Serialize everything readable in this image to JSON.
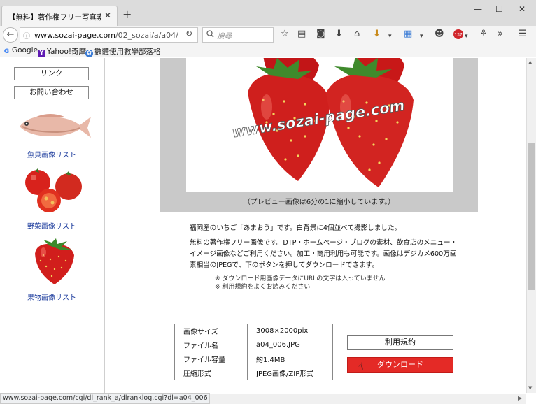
{
  "browser": {
    "tab_title": "【無料】著作権フリー写真素...",
    "new_tab": "+",
    "window_controls": [
      "—",
      "☐",
      "✕"
    ],
    "url_prefix": "www.sozai-page.com",
    "url_path": "/02_sozai/a/a04/",
    "search_placeholder": "搜尋",
    "toolbar_icons": [
      "star-icon",
      "reading-list-icon",
      "pocket-icon",
      "download-icon",
      "home-icon",
      "extension-download-icon",
      "extension-grid-icon",
      "chat-icon",
      "adblock-icon",
      "extension-icon",
      "overflow-icon",
      "menu-icon"
    ],
    "adblock_count": "137"
  },
  "bookmarks": [
    {
      "label": "Google",
      "icon": "google-icon"
    },
    {
      "label": "Yahoo!奇摩",
      "icon": "yahoo-icon"
    },
    {
      "label": "數體使用數學部落格",
      "icon": "blog-icon"
    }
  ],
  "sidebar": {
    "buttons": [
      "リンク",
      "お問い合わせ"
    ],
    "categories": [
      {
        "label": "魚貝画像リスト",
        "icon": "fish-thumbnail"
      },
      {
        "label": "野菜画像リスト",
        "icon": "tomato-thumbnail"
      },
      {
        "label": "果物画像リスト",
        "icon": "strawberry-thumbnail"
      }
    ]
  },
  "preview": {
    "watermark": "www.sozai-page.com",
    "note": "（プレビュー画像は6分の1に縮小しています。）"
  },
  "description": {
    "line1": "福岡産のいちご「あまおう」です。白背景に4個並べて撮影しました。",
    "line2": "無料の著作権フリー画像です。DTP・ホームページ・ブログの素材、飲食店のメニュー・",
    "line3": "イメージ画像などご利用ください。加工・商用利用も可能です。画像はデジカメ600万画",
    "line4": "素相当のJPEGで、下のボタンを押してダウンロードできます。",
    "note1": "※ ダウンロード用画像データにURLの文字は入っていません",
    "note2": "※ 利用規約をよくお読みください"
  },
  "info_table": [
    {
      "key": "画像サイズ",
      "value": "3008×2000pix"
    },
    {
      "key": "ファイル名",
      "value": "a04_006.JPG"
    },
    {
      "key": "ファイル容量",
      "value": "約1.4MB"
    },
    {
      "key": "圧縮形式",
      "value": "JPEG画像/ZIP形式"
    }
  ],
  "buttons": {
    "terms": "利用規約",
    "download": "ダウンロード"
  },
  "status_bar": "www.sozai-page.com/cgi/dl_rank_a/dlranklog.cgi?dl=a04_006",
  "colors": {
    "download_button": "#e42a26",
    "link": "#1a3a9c",
    "preview_frame": "#c9c9c9"
  }
}
